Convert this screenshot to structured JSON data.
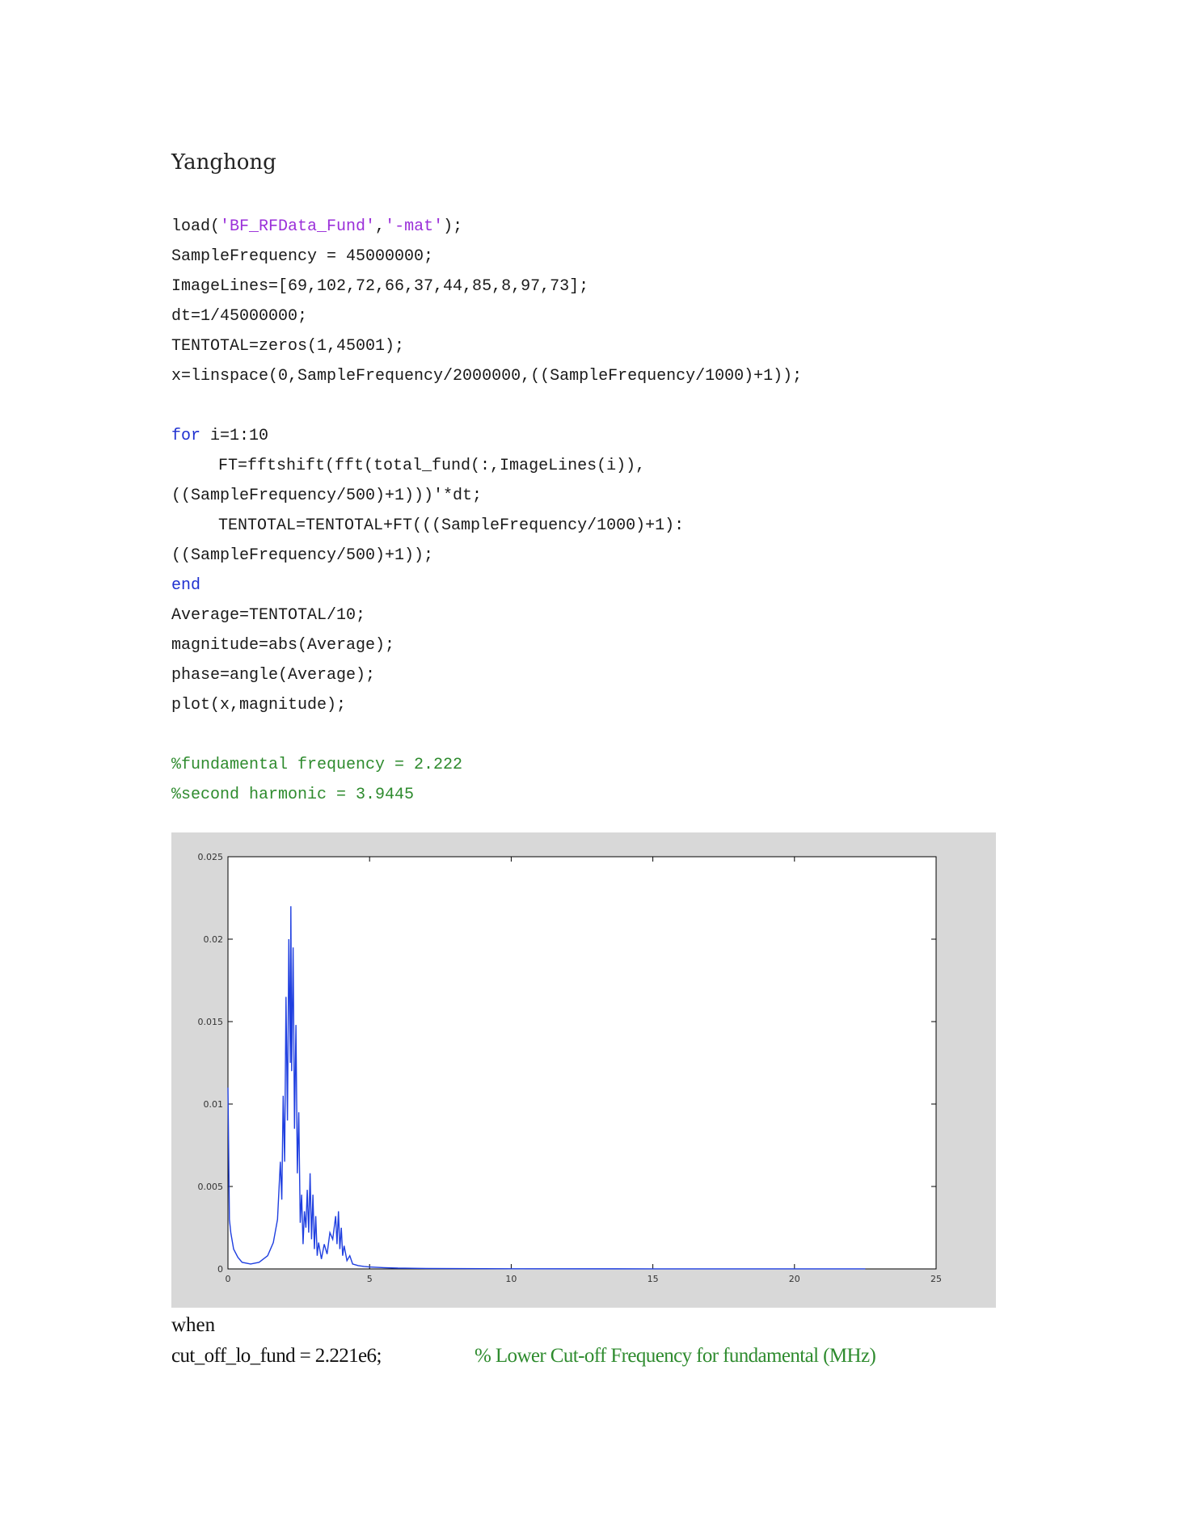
{
  "document": {
    "author": "Yanghong"
  },
  "code_lines": [
    {
      "type": "line",
      "parts": [
        {
          "t": "load(",
          "c": ""
        },
        {
          "t": "'BF_RFData_Fund'",
          "c": "str"
        },
        {
          "t": ",",
          "c": ""
        },
        {
          "t": "'-mat'",
          "c": "str"
        },
        {
          "t": ");",
          "c": ""
        }
      ]
    },
    {
      "type": "line",
      "parts": [
        {
          "t": "SampleFrequency = 45000000;",
          "c": ""
        }
      ]
    },
    {
      "type": "line",
      "parts": [
        {
          "t": "ImageLines=[69,102,72,66,37,44,85,8,97,73];",
          "c": ""
        }
      ]
    },
    {
      "type": "line",
      "parts": [
        {
          "t": "dt=1/45000000;",
          "c": ""
        }
      ]
    },
    {
      "type": "line",
      "parts": [
        {
          "t": "TENTOTAL=zeros(1,45001);",
          "c": ""
        }
      ]
    },
    {
      "type": "line",
      "parts": [
        {
          "t": "x=linspace(0,SampleFrequency/2000000,((SampleFrequency/1000)+1));",
          "c": ""
        }
      ]
    },
    {
      "type": "blank"
    },
    {
      "type": "line",
      "parts": [
        {
          "t": "for",
          "c": "kw"
        },
        {
          "t": " i=1:10",
          "c": ""
        }
      ]
    },
    {
      "type": "line",
      "indent": true,
      "parts": [
        {
          "t": "FT=fftshift(fft(total_fund(:,ImageLines(i)),",
          "c": ""
        }
      ]
    },
    {
      "type": "line",
      "parts": [
        {
          "t": "((SampleFrequency/500)+1)))'*dt;",
          "c": ""
        }
      ]
    },
    {
      "type": "line",
      "indent": true,
      "parts": [
        {
          "t": "TENTOTAL=TENTOTAL+FT(((SampleFrequency/1000)+1):",
          "c": ""
        }
      ]
    },
    {
      "type": "line",
      "parts": [
        {
          "t": "((SampleFrequency/500)+1));",
          "c": ""
        }
      ]
    },
    {
      "type": "line",
      "parts": [
        {
          "t": "end",
          "c": "kw"
        }
      ]
    },
    {
      "type": "line",
      "parts": [
        {
          "t": "Average=TENTOTAL/10;",
          "c": ""
        }
      ]
    },
    {
      "type": "line",
      "parts": [
        {
          "t": "magnitude=abs(Average);",
          "c": ""
        }
      ]
    },
    {
      "type": "line",
      "parts": [
        {
          "t": "phase=angle(Average);",
          "c": ""
        }
      ]
    },
    {
      "type": "line",
      "parts": [
        {
          "t": "plot(x,magnitude);",
          "c": ""
        }
      ]
    },
    {
      "type": "blank"
    },
    {
      "type": "line",
      "parts": [
        {
          "t": "%fundamental frequency = 2.222",
          "c": "cm"
        }
      ]
    },
    {
      "type": "line",
      "parts": [
        {
          "t": "%second harmonic = 3.9445",
          "c": "cm"
        }
      ]
    }
  ],
  "bottom": {
    "when": "when",
    "cutoff_code": "cut_off_lo_fund = 2.221e6;",
    "cutoff_comment": "% Lower Cut-off Frequency for fundamental (MHz)"
  },
  "colors": {
    "line": "#1f3fe0",
    "figure_bg": "#d8d8d8",
    "string": "#9b30d9",
    "keyword": "#1f30d0",
    "comment": "#2e8b2e"
  },
  "chart_data": {
    "type": "line",
    "title": "",
    "xlabel": "",
    "ylabel": "",
    "xlim": [
      0,
      25
    ],
    "ylim": [
      0,
      0.025
    ],
    "xticks": [
      "0",
      "5",
      "10",
      "15",
      "20",
      "25"
    ],
    "yticks": [
      "0",
      "0.005",
      "0.01",
      "0.015",
      "0.02",
      "0.025"
    ],
    "grid": false,
    "series": [
      {
        "x": [
          0,
          0.05,
          0.1,
          0.2,
          0.35,
          0.5,
          0.8,
          1.1,
          1.4,
          1.6,
          1.75,
          1.85,
          1.9,
          1.95,
          2.0,
          2.05,
          2.1,
          2.15,
          2.2,
          2.22,
          2.25,
          2.3,
          2.35,
          2.4,
          2.45,
          2.5,
          2.55,
          2.6,
          2.65,
          2.7,
          2.75,
          2.8,
          2.85,
          2.9,
          2.95,
          3.0,
          3.05,
          3.1,
          3.15,
          3.2,
          3.3,
          3.4,
          3.5,
          3.6,
          3.7,
          3.8,
          3.85,
          3.9,
          3.95,
          4.0,
          4.05,
          4.1,
          4.2,
          4.3,
          4.4,
          4.6,
          4.8,
          5.0,
          5.5,
          6.0,
          7.0,
          8.0,
          10.0,
          15.0,
          20.0,
          22.5
        ],
        "y": [
          0.011,
          0.003,
          0.0022,
          0.0012,
          0.0007,
          0.0004,
          0.0003,
          0.0004,
          0.0008,
          0.0016,
          0.003,
          0.0065,
          0.0042,
          0.0105,
          0.0065,
          0.0165,
          0.009,
          0.02,
          0.0125,
          0.022,
          0.012,
          0.0195,
          0.0085,
          0.0148,
          0.0058,
          0.0095,
          0.0028,
          0.0045,
          0.0015,
          0.0035,
          0.0025,
          0.0048,
          0.0022,
          0.0058,
          0.0018,
          0.0045,
          0.0012,
          0.0032,
          0.0008,
          0.0016,
          0.0006,
          0.0015,
          0.0009,
          0.0022,
          0.0018,
          0.0032,
          0.0015,
          0.0035,
          0.0012,
          0.0025,
          0.0008,
          0.0014,
          0.0005,
          0.0008,
          0.0003,
          0.0002,
          0.00015,
          0.00012,
          8e-05,
          5e-05,
          3e-05,
          2e-05,
          1e-05,
          5e-06,
          5e-06,
          5e-06
        ]
      }
    ]
  }
}
